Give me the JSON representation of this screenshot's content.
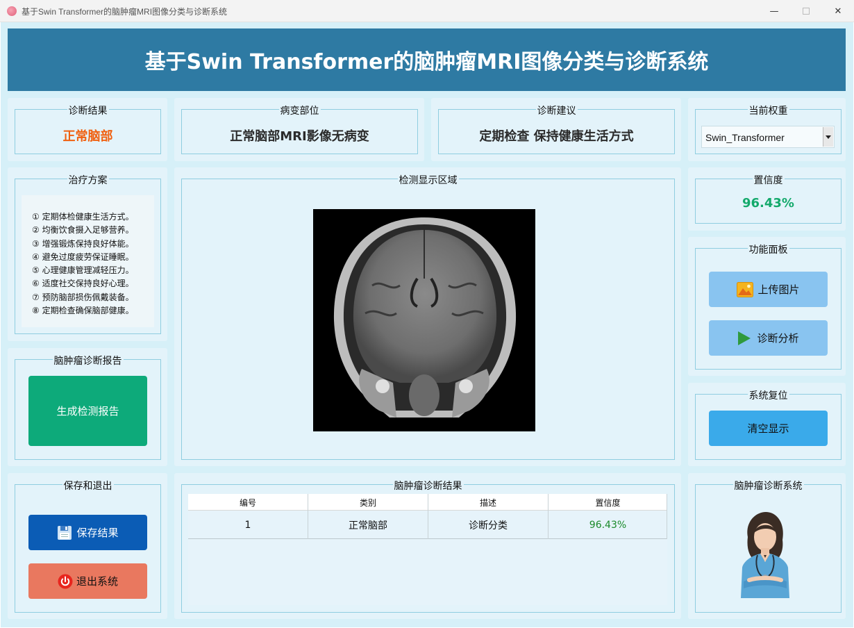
{
  "window": {
    "title": "基于Swin Transformer的脑肿瘤MRI图像分类与诊断系统",
    "min_glyph": "—",
    "close_glyph": "✕"
  },
  "header": {
    "title": "基于Swin Transformer的脑肿瘤MRI图像分类与诊断系统"
  },
  "result": {
    "label": "诊断结果",
    "value": "正常脑部"
  },
  "lesion": {
    "label": "病变部位",
    "value": "正常脑部MRI影像无病变"
  },
  "advice": {
    "label": "诊断建议",
    "value": "定期检查 保持健康生活方式"
  },
  "weights": {
    "label": "当前权重",
    "selected": "Swin_Transformer"
  },
  "plan": {
    "label": "治疗方案",
    "items": [
      "① 定期体检健康生活方式。",
      "② 均衡饮食摄入足够营养。",
      "③ 增强锻炼保持良好体能。",
      "④ 避免过度疲劳保证睡眠。",
      "⑤ 心理健康管理减轻压力。",
      "⑥ 适度社交保持良好心理。",
      "⑦ 预防脑部损伤佩戴装备。",
      "⑧ 定期检查确保脑部健康。"
    ]
  },
  "display": {
    "label": "检测显示区域"
  },
  "confidence": {
    "label": "置信度",
    "value": "96.43%"
  },
  "functions": {
    "label": "功能面板",
    "upload": "上传图片",
    "analyze": "诊断分析"
  },
  "reset": {
    "label": "系统复位",
    "clear": "清空显示"
  },
  "report": {
    "label": "脑肿瘤诊断报告",
    "generate": "生成检测报告"
  },
  "save_exit": {
    "label": "保存和退出",
    "save": "保存结果",
    "exit": "退出系统"
  },
  "results_table": {
    "label": "脑肿瘤诊断结果",
    "columns": [
      "编号",
      "类别",
      "描述",
      "置信度"
    ],
    "rows": [
      [
        "1",
        "正常脑部",
        "诊断分类",
        "96.43%"
      ]
    ]
  },
  "brand": {
    "label": "脑肿瘤诊断系统"
  },
  "colors": {
    "header_bg": "#2e7aa3",
    "result_orange": "#f06010",
    "confidence_green": "#13a96b",
    "report_button": "#0daa7a",
    "save_button": "#0b5cb5",
    "exit_button": "#e9785f",
    "function_button": "#89c4f0",
    "clear_button": "#3aaaea"
  }
}
